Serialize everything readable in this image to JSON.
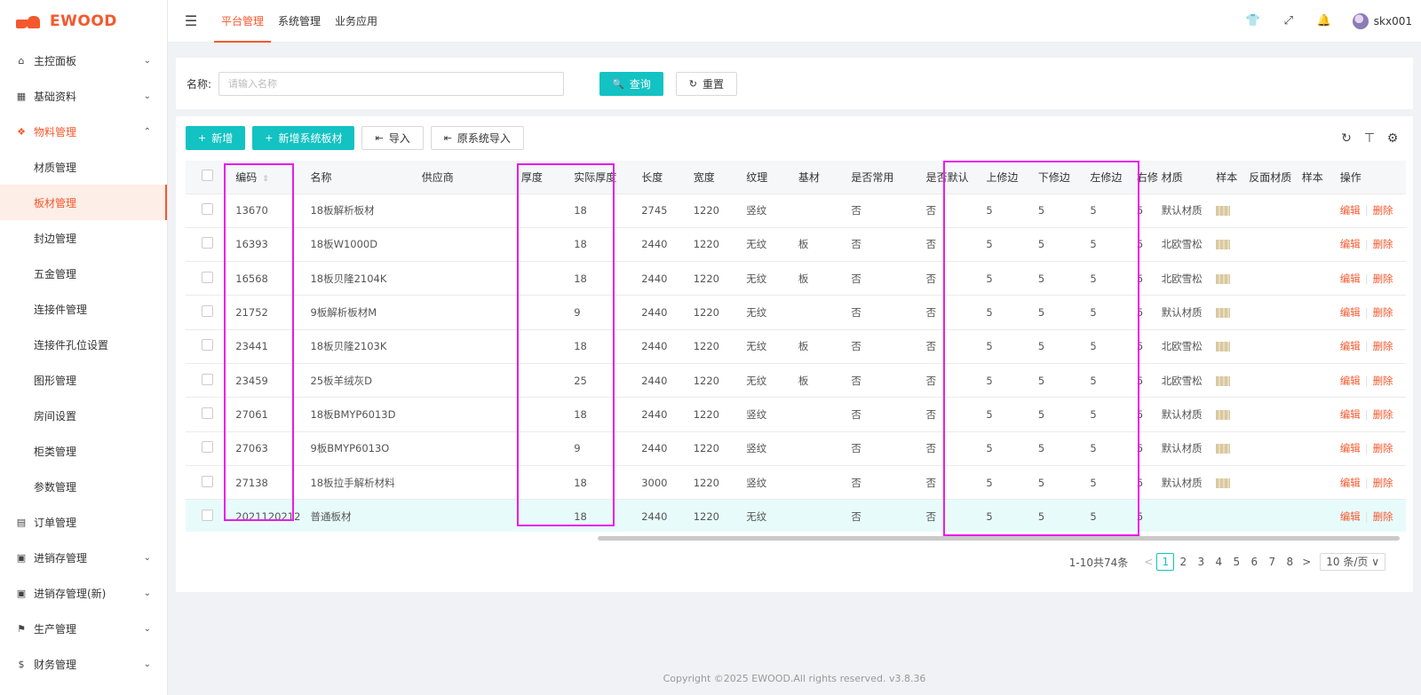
{
  "brand": {
    "name": "EWOOD"
  },
  "sidebar": {
    "items": [
      {
        "label": "主控面板",
        "icon": "home-icon",
        "glyph": "⌂",
        "arrow": "⌄"
      },
      {
        "label": "基础资料",
        "icon": "grid-icon",
        "glyph": "▦",
        "arrow": "⌄"
      },
      {
        "label": "物料管理",
        "icon": "material-icon",
        "glyph": "❖",
        "arrow": "⌃"
      }
    ],
    "subitems": [
      "材质管理",
      "板材管理",
      "封边管理",
      "五金管理",
      "连接件管理",
      "连接件孔位设置",
      "图形管理",
      "房间设置",
      "柜类管理",
      "参数管理"
    ],
    "bottom_items": [
      {
        "label": "订单管理",
        "icon": "order-icon",
        "glyph": "▤",
        "arrow": ""
      },
      {
        "label": "进销存管理",
        "icon": "inventory-icon",
        "glyph": "▣",
        "arrow": "⌄"
      },
      {
        "label": "进销存管理(新)",
        "icon": "inventory-new-icon",
        "glyph": "▣",
        "arrow": "⌄"
      },
      {
        "label": "生产管理",
        "icon": "flag-icon",
        "glyph": "⚑",
        "arrow": "⌄"
      },
      {
        "label": "财务管理",
        "icon": "finance-icon",
        "glyph": "$",
        "arrow": "⌄"
      }
    ]
  },
  "header": {
    "fold_glyph": "☰",
    "tabs": [
      "平台管理",
      "系统管理",
      "业务应用"
    ],
    "icons": {
      "shirt": "👕",
      "expand": "⤢",
      "bell": "🔔"
    },
    "username": "skx001"
  },
  "search": {
    "label": "名称:",
    "placeholder": "请输入名称",
    "query": "查询",
    "reset": "重置",
    "query_icon": "🔍",
    "reset_icon": "↻"
  },
  "toolbar": {
    "add": "新增",
    "add_system": "新增系统板材",
    "import": "导入",
    "import_old": "原系统导入",
    "plus": "+",
    "import_icon": "⇤",
    "icons": {
      "refresh": "↻",
      "density": "⊤",
      "settings": "⚙"
    }
  },
  "table": {
    "columns": [
      "编码",
      "名称",
      "供应商",
      "厚度",
      "实际厚度",
      "长度",
      "宽度",
      "纹理",
      "基材",
      "是否常用",
      "是否默认",
      "上修边",
      "下修边",
      "左修边",
      "右修",
      "材质",
      "样本",
      "反面材质",
      "样本",
      "操作"
    ],
    "sort_glyph": "⇕",
    "rows": [
      [
        "13670",
        "18板解析板材",
        "",
        "",
        "18",
        "2745",
        "1220",
        "竖纹",
        "",
        "否",
        "否",
        "5",
        "5",
        "5",
        "5",
        "默认材质"
      ],
      [
        "16393",
        "18板W1000D",
        "",
        "",
        "18",
        "2440",
        "1220",
        "无纹",
        "板",
        "否",
        "否",
        "5",
        "5",
        "5",
        "5",
        "北欧雪松"
      ],
      [
        "16568",
        "18板贝隆2104K",
        "",
        "",
        "18",
        "2440",
        "1220",
        "无纹",
        "板",
        "否",
        "否",
        "5",
        "5",
        "5",
        "5",
        "北欧雪松"
      ],
      [
        "21752",
        "9板解析板材M",
        "",
        "",
        "9",
        "2440",
        "1220",
        "无纹",
        "",
        "否",
        "否",
        "5",
        "5",
        "5",
        "5",
        "默认材质"
      ],
      [
        "23441",
        "18板贝隆2103K",
        "",
        "",
        "18",
        "2440",
        "1220",
        "无纹",
        "板",
        "否",
        "否",
        "5",
        "5",
        "5",
        "5",
        "北欧雪松"
      ],
      [
        "23459",
        "25板羊绒灰D",
        "",
        "",
        "25",
        "2440",
        "1220",
        "无纹",
        "板",
        "否",
        "否",
        "5",
        "5",
        "5",
        "5",
        "北欧雪松"
      ],
      [
        "27061",
        "18板BMYP6013D",
        "",
        "",
        "18",
        "2440",
        "1220",
        "竖纹",
        "",
        "否",
        "否",
        "5",
        "5",
        "5",
        "5",
        "默认材质"
      ],
      [
        "27063",
        "9板BMYP6013O",
        "",
        "",
        "9",
        "2440",
        "1220",
        "竖纹",
        "",
        "否",
        "否",
        "5",
        "5",
        "5",
        "5",
        "默认材质"
      ],
      [
        "27138",
        "18板拉手解析材料",
        "",
        "",
        "18",
        "3000",
        "1220",
        "竖纹",
        "",
        "否",
        "否",
        "5",
        "5",
        "5",
        "5",
        "默认材质"
      ],
      [
        "2021120212",
        "普通板材",
        "",
        "",
        "18",
        "2440",
        "1220",
        "无纹",
        "",
        "否",
        "否",
        "5",
        "5",
        "5",
        "5",
        ""
      ]
    ],
    "sample_flags": [
      true,
      true,
      true,
      true,
      true,
      true,
      true,
      true,
      true,
      false
    ],
    "actions": {
      "edit": "编辑",
      "delete": "删除",
      "sep": "|"
    }
  },
  "pagination": {
    "total": "1-10共74条",
    "prev": "<",
    "pages": [
      "1",
      "2",
      "3",
      "4",
      "5",
      "6",
      "7",
      "8"
    ],
    "current": "1",
    "next": ">",
    "page_size": "10 条/页 ∨"
  },
  "footer": "Copyright ©2025 EWOOD.All rights reserved. v3.8.36",
  "colors": {
    "accent": "#f5582d",
    "primary": "#13c2c2",
    "highlight_box": "#e91ce9"
  }
}
